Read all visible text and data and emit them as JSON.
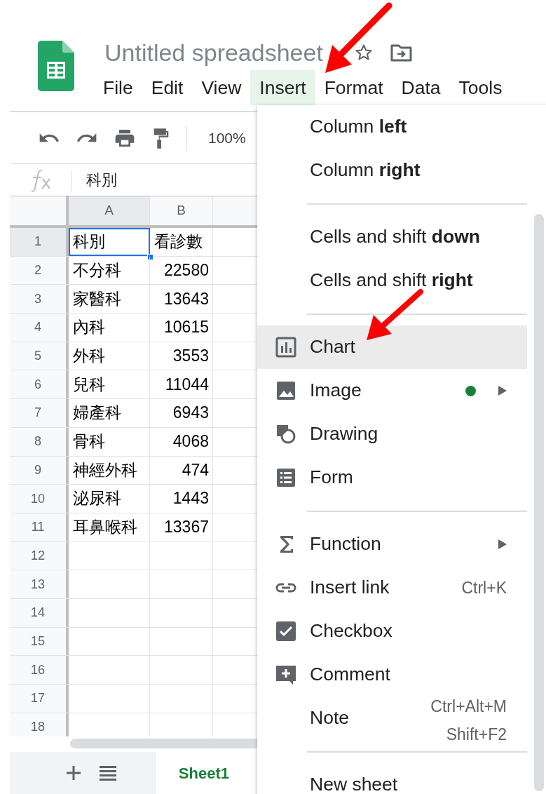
{
  "document": {
    "title": "Untitled spreadsheet"
  },
  "menu_bar": [
    {
      "label": "File",
      "selected": false
    },
    {
      "label": "Edit",
      "selected": false
    },
    {
      "label": "View",
      "selected": false
    },
    {
      "label": "Insert",
      "selected": true
    },
    {
      "label": "Format",
      "selected": false
    },
    {
      "label": "Data",
      "selected": false
    },
    {
      "label": "Tools",
      "selected": false
    }
  ],
  "toolbar": {
    "zoom": "100%"
  },
  "formula_bar": {
    "content": "科別"
  },
  "grid": {
    "columns": [
      {
        "label": "A",
        "selected": true
      },
      {
        "label": "B",
        "selected": false
      }
    ],
    "rows": [
      {
        "number": "1",
        "selected": true,
        "cells": [
          {
            "text": "科別",
            "kind": "text",
            "selected": true
          },
          {
            "text": "看診數",
            "kind": "text",
            "selected": false
          }
        ]
      },
      {
        "number": "2",
        "selected": false,
        "cells": [
          {
            "text": "不分科",
            "kind": "text",
            "selected": false
          },
          {
            "text": "22580",
            "kind": "number",
            "selected": false
          }
        ]
      },
      {
        "number": "3",
        "selected": false,
        "cells": [
          {
            "text": "家醫科",
            "kind": "text",
            "selected": false
          },
          {
            "text": "13643",
            "kind": "number",
            "selected": false
          }
        ]
      },
      {
        "number": "4",
        "selected": false,
        "cells": [
          {
            "text": "內科",
            "kind": "text",
            "selected": false
          },
          {
            "text": "10615",
            "kind": "number",
            "selected": false
          }
        ]
      },
      {
        "number": "5",
        "selected": false,
        "cells": [
          {
            "text": "外科",
            "kind": "text",
            "selected": false
          },
          {
            "text": "3553",
            "kind": "number",
            "selected": false
          }
        ]
      },
      {
        "number": "6",
        "selected": false,
        "cells": [
          {
            "text": "兒科",
            "kind": "text",
            "selected": false
          },
          {
            "text": "11044",
            "kind": "number",
            "selected": false
          }
        ]
      },
      {
        "number": "7",
        "selected": false,
        "cells": [
          {
            "text": "婦產科",
            "kind": "text",
            "selected": false
          },
          {
            "text": "6943",
            "kind": "number",
            "selected": false
          }
        ]
      },
      {
        "number": "8",
        "selected": false,
        "cells": [
          {
            "text": "骨科",
            "kind": "text",
            "selected": false
          },
          {
            "text": "4068",
            "kind": "number",
            "selected": false
          }
        ]
      },
      {
        "number": "9",
        "selected": false,
        "cells": [
          {
            "text": "神經外科",
            "kind": "text",
            "selected": false
          },
          {
            "text": "474",
            "kind": "number",
            "selected": false
          }
        ]
      },
      {
        "number": "10",
        "selected": false,
        "cells": [
          {
            "text": "泌尿科",
            "kind": "text",
            "selected": false
          },
          {
            "text": "1443",
            "kind": "number",
            "selected": false
          }
        ]
      },
      {
        "number": "11",
        "selected": false,
        "cells": [
          {
            "text": "耳鼻喉科",
            "kind": "text",
            "selected": false
          },
          {
            "text": "13367",
            "kind": "number",
            "selected": false
          }
        ]
      },
      {
        "number": "12",
        "selected": false
      },
      {
        "number": "13",
        "selected": false
      },
      {
        "number": "14",
        "selected": false
      },
      {
        "number": "15",
        "selected": false
      },
      {
        "number": "16",
        "selected": false
      },
      {
        "number": "17",
        "selected": false
      },
      {
        "number": "18",
        "selected": false
      }
    ]
  },
  "sheet_tabs": [
    {
      "label": "Sheet1",
      "selected": true
    }
  ],
  "insert_menu": [
    {
      "kind": "item",
      "label": "Column **left**",
      "highlighted": false
    },
    {
      "kind": "item",
      "label": "Column **right**",
      "highlighted": false
    },
    {
      "kind": "separator"
    },
    {
      "kind": "item",
      "label": "Cells and shift **down**",
      "highlighted": false
    },
    {
      "kind": "item",
      "label": "Cells and shift **right**",
      "highlighted": false
    },
    {
      "kind": "separator"
    },
    {
      "kind": "item",
      "label": "Chart",
      "highlighted": true
    },
    {
      "kind": "item",
      "label": "Image",
      "highlighted": false,
      "new_dot": true,
      "submenu": true
    },
    {
      "kind": "item",
      "label": "Drawing",
      "highlighted": false
    },
    {
      "kind": "item",
      "label": "Form",
      "highlighted": false
    },
    {
      "kind": "separator"
    },
    {
      "kind": "item",
      "label": "Function",
      "highlighted": false,
      "submenu": true
    },
    {
      "kind": "item",
      "label": "Insert link",
      "highlighted": false,
      "shortcuts": [
        "Ctrl+K"
      ]
    },
    {
      "kind": "item",
      "label": "Checkbox",
      "highlighted": false
    },
    {
      "kind": "item",
      "label": "Comment",
      "highlighted": false
    },
    {
      "kind": "item",
      "label": "Note",
      "highlighted": false,
      "shortcuts": [
        "Ctrl+Alt+M",
        "Shift+F2"
      ]
    },
    {
      "kind": "separator"
    },
    {
      "kind": "item",
      "label": "New sheet",
      "highlighted": false
    }
  ]
}
